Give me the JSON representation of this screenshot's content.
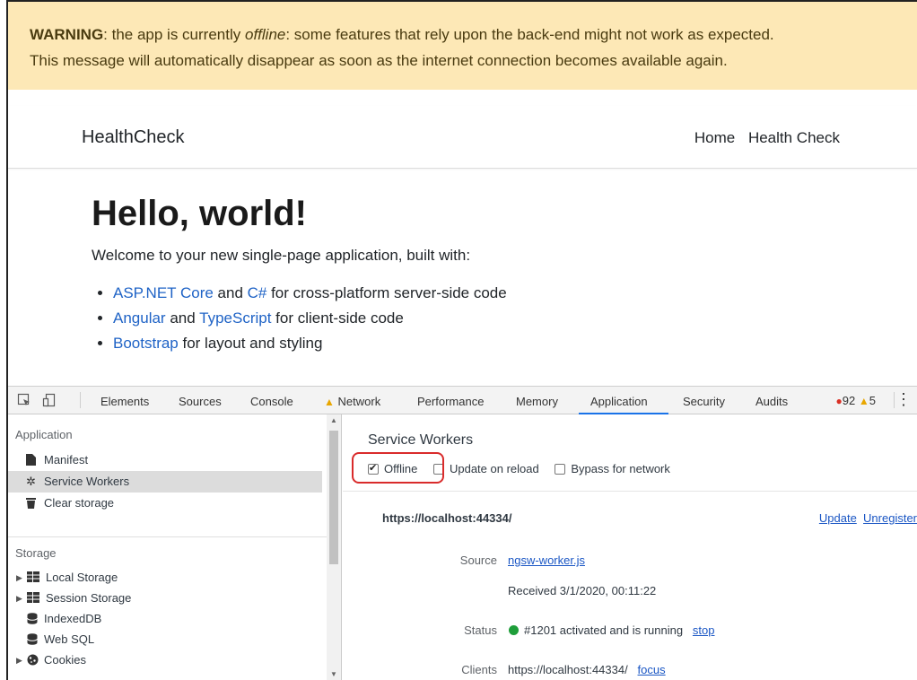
{
  "warning": {
    "label": "WARNING",
    "text_before": ": the app is currently ",
    "offline_word": "offline",
    "text_after": ": some features that rely upon the back-end might not work as expected.",
    "line2": "This message will automatically disappear as soon as the internet connection becomes available again."
  },
  "navbar": {
    "brand": "HealthCheck",
    "links": [
      "Home",
      "Health Check"
    ]
  },
  "content": {
    "heading": "Hello, world!",
    "welcome": "Welcome to your new single-page application, built with:",
    "items": [
      {
        "link1": "ASP.NET Core",
        "mid": " and ",
        "link2": "C#",
        "rest": " for cross-platform server-side code"
      },
      {
        "link1": "Angular",
        "mid": " and ",
        "link2": "TypeScript",
        "rest": " for client-side code"
      },
      {
        "link1": "Bootstrap",
        "mid": "",
        "link2": "",
        "rest": " for layout and styling"
      }
    ]
  },
  "devtools": {
    "tabs": [
      "Elements",
      "Sources",
      "Console",
      "Network",
      "Performance",
      "Memory",
      "Application",
      "Security",
      "Audits"
    ],
    "active_tab": "Application",
    "error_count": "92",
    "warning_count": "5",
    "sidebar": {
      "application_header": "Application",
      "application_items": [
        "Manifest",
        "Service Workers",
        "Clear storage"
      ],
      "selected_item": "Service Workers",
      "storage_header": "Storage",
      "storage_items": [
        "Local Storage",
        "Session Storage",
        "IndexedDB",
        "Web SQL",
        "Cookies"
      ]
    },
    "main": {
      "title": "Service Workers",
      "options": [
        {
          "label": "Offline",
          "checked": true
        },
        {
          "label": "Update on reload",
          "checked": false
        },
        {
          "label": "Bypass for network",
          "checked": false
        }
      ],
      "origin": "https://localhost:44334/",
      "update_label": "Update",
      "unregister_label": "Unregister",
      "source_label": "Source",
      "source_value": "ngsw-worker.js",
      "received": "Received 3/1/2020, 00:11:22",
      "status_label": "Status",
      "status_value": "#1201 activated and is running",
      "stop_label": "stop",
      "clients_label": "Clients",
      "clients_value": "https://localhost:44334/",
      "focus_label": "focus"
    }
  },
  "colors": {
    "warning_bg": "#fde8b6",
    "link": "#1f63c6",
    "highlight": "#d92b2b",
    "status_green": "#1e9e3a"
  }
}
